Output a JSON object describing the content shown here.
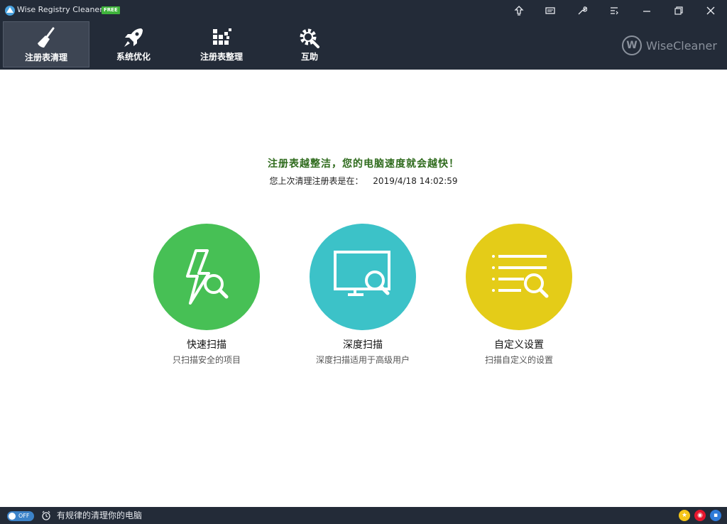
{
  "window": {
    "title": "Wise Registry Cleaner 9",
    "badge": "FREE"
  },
  "titlebar_buttons": [
    {
      "name": "upgrade-icon"
    },
    {
      "name": "feedback-icon"
    },
    {
      "name": "tools-icon"
    },
    {
      "name": "menu-icon"
    },
    {
      "name": "minimize-icon"
    },
    {
      "name": "restore-icon"
    },
    {
      "name": "close-icon"
    }
  ],
  "toolbar": {
    "items": [
      {
        "label": "注册表清理",
        "icon": "broom-icon",
        "active": true
      },
      {
        "label": "系统优化",
        "icon": "rocket-icon",
        "active": false
      },
      {
        "label": "注册表整理",
        "icon": "defrag-icon",
        "active": false
      },
      {
        "label": "互助",
        "icon": "gear-wrench-icon",
        "active": false
      }
    ],
    "brand": "WiseCleaner",
    "brand_mark": "W"
  },
  "main": {
    "headline": "注册表越整洁，您的电脑速度就会越快！",
    "last_clean_label": "您上次清理注册表是在：",
    "last_clean_time": "2019/4/18 14:02:59",
    "scans": [
      {
        "title": "快速扫描",
        "desc": "只扫描安全的项目",
        "color": "#47c055",
        "icon": "lightning-search-icon"
      },
      {
        "title": "深度扫描",
        "desc": "深度扫描适用于高级用户",
        "color": "#3cc2c8",
        "icon": "monitor-search-icon"
      },
      {
        "title": "自定义设置",
        "desc": "扫描自定义的设置",
        "color": "#e4cc18",
        "icon": "list-search-icon"
      }
    ]
  },
  "statusbar": {
    "toggle_text": "OFF",
    "schedule_text": "有规律的清理你的电脑",
    "social": [
      {
        "name": "like-icon",
        "color": "#f5c518"
      },
      {
        "name": "weibo-icon",
        "color": "#e6162d"
      },
      {
        "name": "tieba-icon",
        "color": "#2f7bd9"
      }
    ]
  }
}
